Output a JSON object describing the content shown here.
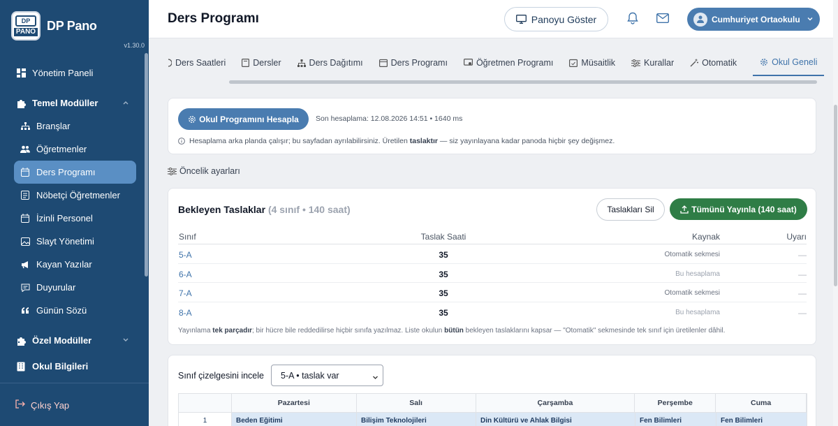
{
  "app": {
    "name": "DP Pano",
    "logo_text": "DP PANO",
    "version": "v1.30.0"
  },
  "sidebar": {
    "items": [
      {
        "label": "Yönetim Paneli",
        "icon": "dashboard-icon"
      },
      {
        "label": "Temel Modüller",
        "icon": "puzzle-icon",
        "expanded": true
      },
      {
        "label": "Branşlar",
        "icon": "hierarchy-icon"
      },
      {
        "label": "Öğretmenler",
        "icon": "users-icon"
      },
      {
        "label": "Ders Programı",
        "icon": "calendar-icon",
        "active": true
      },
      {
        "label": "Nöbetçi Öğretmenler",
        "icon": "id-badge-icon"
      },
      {
        "label": "İzinli Personel",
        "icon": "calendar-x-icon"
      },
      {
        "label": "Slayt Yönetimi",
        "icon": "image-icon"
      },
      {
        "label": "Kayan Yazılar",
        "icon": "megaphone-icon"
      },
      {
        "label": "Duyurular",
        "icon": "message-icon"
      },
      {
        "label": "Günün Sözü",
        "icon": "quote-icon"
      },
      {
        "label": "Özel Modüller",
        "icon": "star-puzzle-icon",
        "expanded": false
      },
      {
        "label": "Okul Bilgileri",
        "icon": "building-icon"
      }
    ],
    "logout": "Çıkış Yap"
  },
  "header": {
    "title": "Ders Programı",
    "show_board": "Panoyu Göster",
    "school": "Cumhuriyet Ortaokulu"
  },
  "tabs": [
    {
      "label": "Ders Saatleri"
    },
    {
      "label": "Dersler"
    },
    {
      "label": "Ders Dağıtımı"
    },
    {
      "label": "Ders Programı"
    },
    {
      "label": "Öğretmen Programı"
    },
    {
      "label": "Müsaitlik"
    },
    {
      "label": "Kurallar"
    },
    {
      "label": "Otomatik"
    },
    {
      "label": "Okul Geneli",
      "active": true
    }
  ],
  "compute": {
    "button": "Okul Programını Hesapla",
    "last_calc": "Son hesaplama: 12.08.2026 14:51 • 1640 ms",
    "info_a": "Hesaplama arka planda çalışır; bu sayfadan ayrılabilirsiniz. Üretilen ",
    "info_b": "taslaktır",
    "info_c": " — siz yayınlayana kadar panoda hiçbir şey değişmez."
  },
  "priority": "Öncelik ayarları",
  "drafts": {
    "title": "Bekleyen Taslaklar",
    "count": "(4 sınıf • 140 saat)",
    "delete_btn": "Taslakları Sil",
    "publish_btn": "Tümünü Yayınla (140 saat)",
    "columns": [
      "Sınıf",
      "Taslak Saati",
      "Kaynak",
      "Uyarı"
    ],
    "rows": [
      {
        "class": "5-A",
        "hours": "35",
        "source": "Otomatik sekmesi",
        "warn": "—"
      },
      {
        "class": "6-A",
        "hours": "35",
        "source": "Bu hesaplama",
        "warn": "—"
      },
      {
        "class": "7-A",
        "hours": "35",
        "source": "Otomatik sekmesi",
        "warn": "—"
      },
      {
        "class": "8-A",
        "hours": "35",
        "source": "Bu hesaplama",
        "warn": "—"
      }
    ],
    "note_a": "Yayınlama ",
    "note_b": "tek parçadır",
    "note_c": "; bir hücre bile reddedilirse hiçbir sınıfa yazılmaz. Liste okulun ",
    "note_d": "bütün",
    "note_e": " bekleyen taslaklarını kapsar — \"Otomatik\" sekmesinde tek sınıf için üretilenler dâhil."
  },
  "schedule": {
    "label": "Sınıf çizelgesini incele",
    "selected": "5-A • taslak var",
    "days": [
      "Pazartesi",
      "Salı",
      "Çarşamba",
      "Perşembe",
      "Cuma"
    ],
    "first_row": {
      "index": "1",
      "cells": [
        "Beden Eğitimi",
        "Bilişim Teknolojileri",
        "Din Kültürü ve Ahlak Bilgisi",
        "Fen Bilimleri",
        "Fen Bilimleri"
      ]
    }
  },
  "colors": {
    "sidebar": "#1e4a73",
    "accent": "#4a7cb0",
    "publish": "#2f7d46",
    "active_nav": "#5a8fc4"
  }
}
